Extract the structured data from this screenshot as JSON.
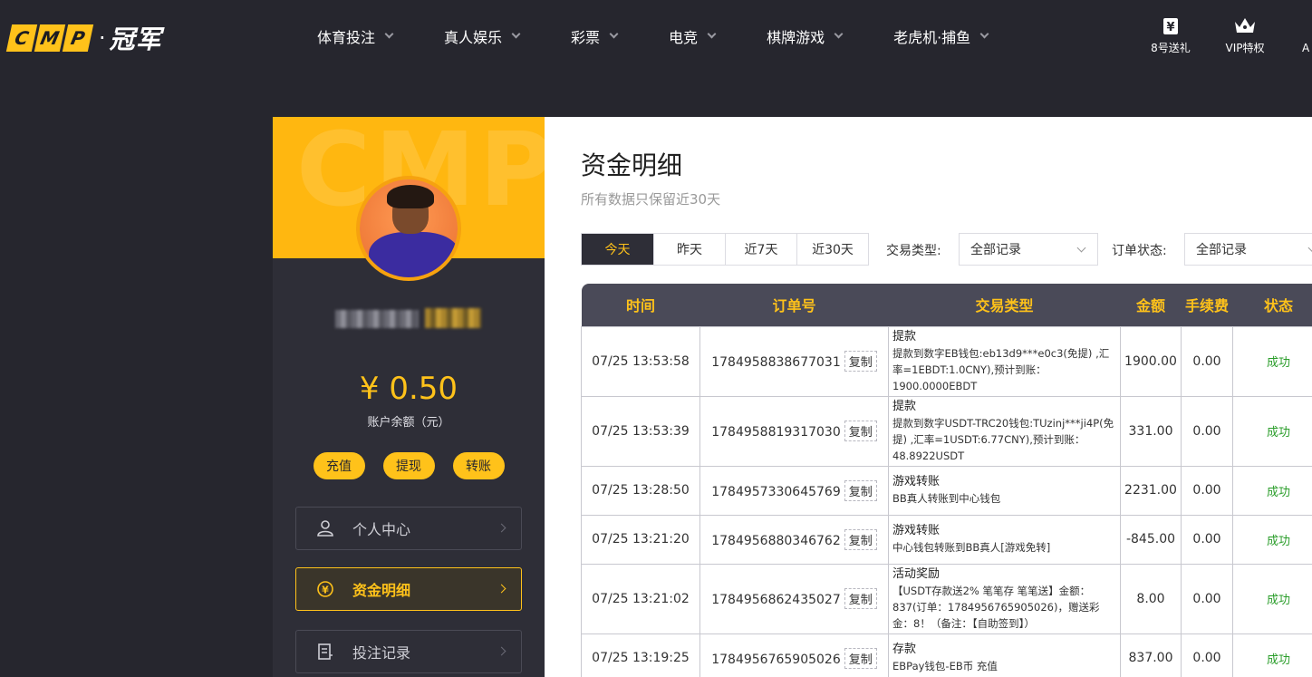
{
  "logo": {
    "letters": [
      "C",
      "M",
      "P"
    ],
    "dot": "·",
    "cn": "冠军"
  },
  "nav": [
    "体育投注",
    "真人娱乐",
    "彩票",
    "电竞",
    "棋牌游戏",
    "老虎机·捕鱼"
  ],
  "nav_right": [
    {
      "icon": "yen-ticket-icon",
      "label": "8号送礼"
    },
    {
      "icon": "crown-icon",
      "label": "VIP特权"
    }
  ],
  "nav_right_cut": "A",
  "sidebar": {
    "banner_text": "CMP",
    "balance": "¥ 0.50",
    "balance_label": "账户余额（元）",
    "actions": [
      "充值",
      "提现",
      "转账"
    ],
    "menu": [
      {
        "icon": "user-icon",
        "label": "个人中心",
        "active": false
      },
      {
        "icon": "yen-circle-icon",
        "label": "资金明细",
        "active": true
      },
      {
        "icon": "document-icon",
        "label": "投注记录",
        "active": false
      }
    ]
  },
  "main": {
    "title": "资金明细",
    "subtitle": "所有数据只保留近30天",
    "date_tabs": [
      "今天",
      "昨天",
      "近7天",
      "近30天"
    ],
    "active_tab": 0,
    "filters": {
      "type_label": "交易类型:",
      "type_value": "全部记录",
      "status_label": "订单状态:",
      "status_value": "全部记录"
    },
    "table": {
      "headers": [
        "时间",
        "订单号",
        "交易类型",
        "金额",
        "手续费",
        "状态"
      ],
      "copy_label": "复制",
      "rows": [
        {
          "time": "07/25 13:53:58",
          "order": "1784958838677031",
          "type": "提款",
          "detail": "提款到数字EB钱包:eb13d9***e0c3(免提) ,汇率=1EBDT:1.0CNY),预计到账：1900.0000EBDT",
          "amount": "1900.00",
          "fee": "0.00",
          "status": "成功"
        },
        {
          "time": "07/25 13:53:39",
          "order": "1784958819317030",
          "type": "提款",
          "detail": "提款到数字USDT-TRC20钱包:TUzinj***ji4P(免提) ,汇率=1USDT:6.77CNY),预计到账：48.8922USDT",
          "amount": "331.00",
          "fee": "0.00",
          "status": "成功"
        },
        {
          "time": "07/25 13:28:50",
          "order": "1784957330645769",
          "type": "游戏转账",
          "detail": "BB真人转账到中心钱包",
          "amount": "2231.00",
          "fee": "0.00",
          "status": "成功"
        },
        {
          "time": "07/25 13:21:20",
          "order": "1784956880346762",
          "type": "游戏转账",
          "detail": "中心钱包转账到BB真人[游戏免转]",
          "amount": "-845.00",
          "fee": "0.00",
          "status": "成功"
        },
        {
          "time": "07/25 13:21:02",
          "order": "1784956862435027",
          "type": "活动奖励",
          "detail": "【USDT存款送2% 笔笔存 笔笔送】金额：837(订单：1784956765905026)，赠送彩金：8！（备注：【自助签到】）",
          "amount": "8.00",
          "fee": "0.00",
          "status": "成功"
        },
        {
          "time": "07/25 13:19:25",
          "order": "1784956765905026",
          "type": "存款",
          "detail": "EBPay钱包-EB币 充值",
          "amount": "837.00",
          "fee": "0.00",
          "status": "成功"
        }
      ]
    }
  },
  "colors": {
    "accent": "#ffc21a",
    "dark": "#26262e",
    "panel": "#2e2e37",
    "success": "#2a9d2a"
  }
}
